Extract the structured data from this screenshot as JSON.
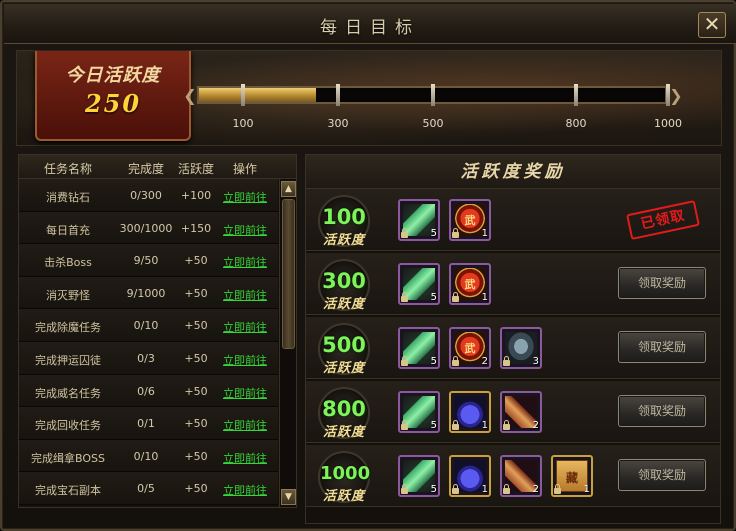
{
  "window": {
    "title": "每日目标",
    "close_label": "✕"
  },
  "activity": {
    "label": "今日活跃度",
    "value": "250",
    "progress_ratio": 0.25,
    "milestones": [
      "100",
      "300",
      "500",
      "800",
      "1000"
    ]
  },
  "tasks": {
    "headers": {
      "name": "任务名称",
      "progress": "完成度",
      "activity": "活跃度",
      "action": "操作"
    },
    "rows": [
      {
        "name": "消费钻石",
        "progress": "0/300",
        "activity": "+100",
        "action": "立即前往"
      },
      {
        "name": "每日首充",
        "progress": "300/1000",
        "activity": "+150",
        "action": "立即前往"
      },
      {
        "name": "击杀Boss",
        "progress": "9/50",
        "activity": "+50",
        "action": "立即前往"
      },
      {
        "name": "消灭野怪",
        "progress": "9/1000",
        "activity": "+50",
        "action": "立即前往"
      },
      {
        "name": "完成除魔任务",
        "progress": "0/10",
        "activity": "+50",
        "action": "立即前往"
      },
      {
        "name": "完成押运囚徒",
        "progress": "0/3",
        "activity": "+50",
        "action": "立即前往"
      },
      {
        "name": "完成威名任务",
        "progress": "0/6",
        "activity": "+50",
        "action": "立即前往"
      },
      {
        "name": "完成回收任务",
        "progress": "0/1",
        "activity": "+50",
        "action": "立即前往"
      },
      {
        "name": "完成缉拿BOSS",
        "progress": "0/10",
        "activity": "+50",
        "action": "立即前往"
      },
      {
        "name": "完成宝石副本",
        "progress": "0/5",
        "activity": "+50",
        "action": "立即前往"
      }
    ],
    "scroll_up": "▲",
    "scroll_down": "▼"
  },
  "rewards": {
    "title": "活跃度奖励",
    "unit_label": "活跃度",
    "claim_label": "领取奖励",
    "claimed_label": "已领取",
    "red_item_glyph": "武",
    "map_item_glyph": "藏",
    "tiers": [
      {
        "value": "100",
        "claimed": true,
        "items": [
          {
            "icon": "green-jade-icon",
            "count": "5"
          },
          {
            "icon": "red-token-icon",
            "count": "1"
          }
        ]
      },
      {
        "value": "300",
        "claimed": false,
        "items": [
          {
            "icon": "green-jade-icon",
            "count": "5"
          },
          {
            "icon": "red-token-icon",
            "count": "1"
          }
        ]
      },
      {
        "value": "500",
        "claimed": false,
        "items": [
          {
            "icon": "green-jade-icon",
            "count": "5"
          },
          {
            "icon": "red-token-icon",
            "count": "2"
          },
          {
            "icon": "armor-icon",
            "count": "3"
          }
        ]
      },
      {
        "value": "800",
        "claimed": false,
        "items": [
          {
            "icon": "green-jade-icon",
            "count": "5"
          },
          {
            "icon": "magic-bag-icon",
            "count": "1"
          },
          {
            "icon": "scroll-icon",
            "count": "2"
          }
        ]
      },
      {
        "value": "1000",
        "claimed": false,
        "items": [
          {
            "icon": "green-jade-icon",
            "count": "5"
          },
          {
            "icon": "magic-bag-icon",
            "count": "1"
          },
          {
            "icon": "scroll-icon",
            "count": "2"
          },
          {
            "icon": "treasure-map-icon",
            "count": "1"
          }
        ]
      }
    ]
  }
}
